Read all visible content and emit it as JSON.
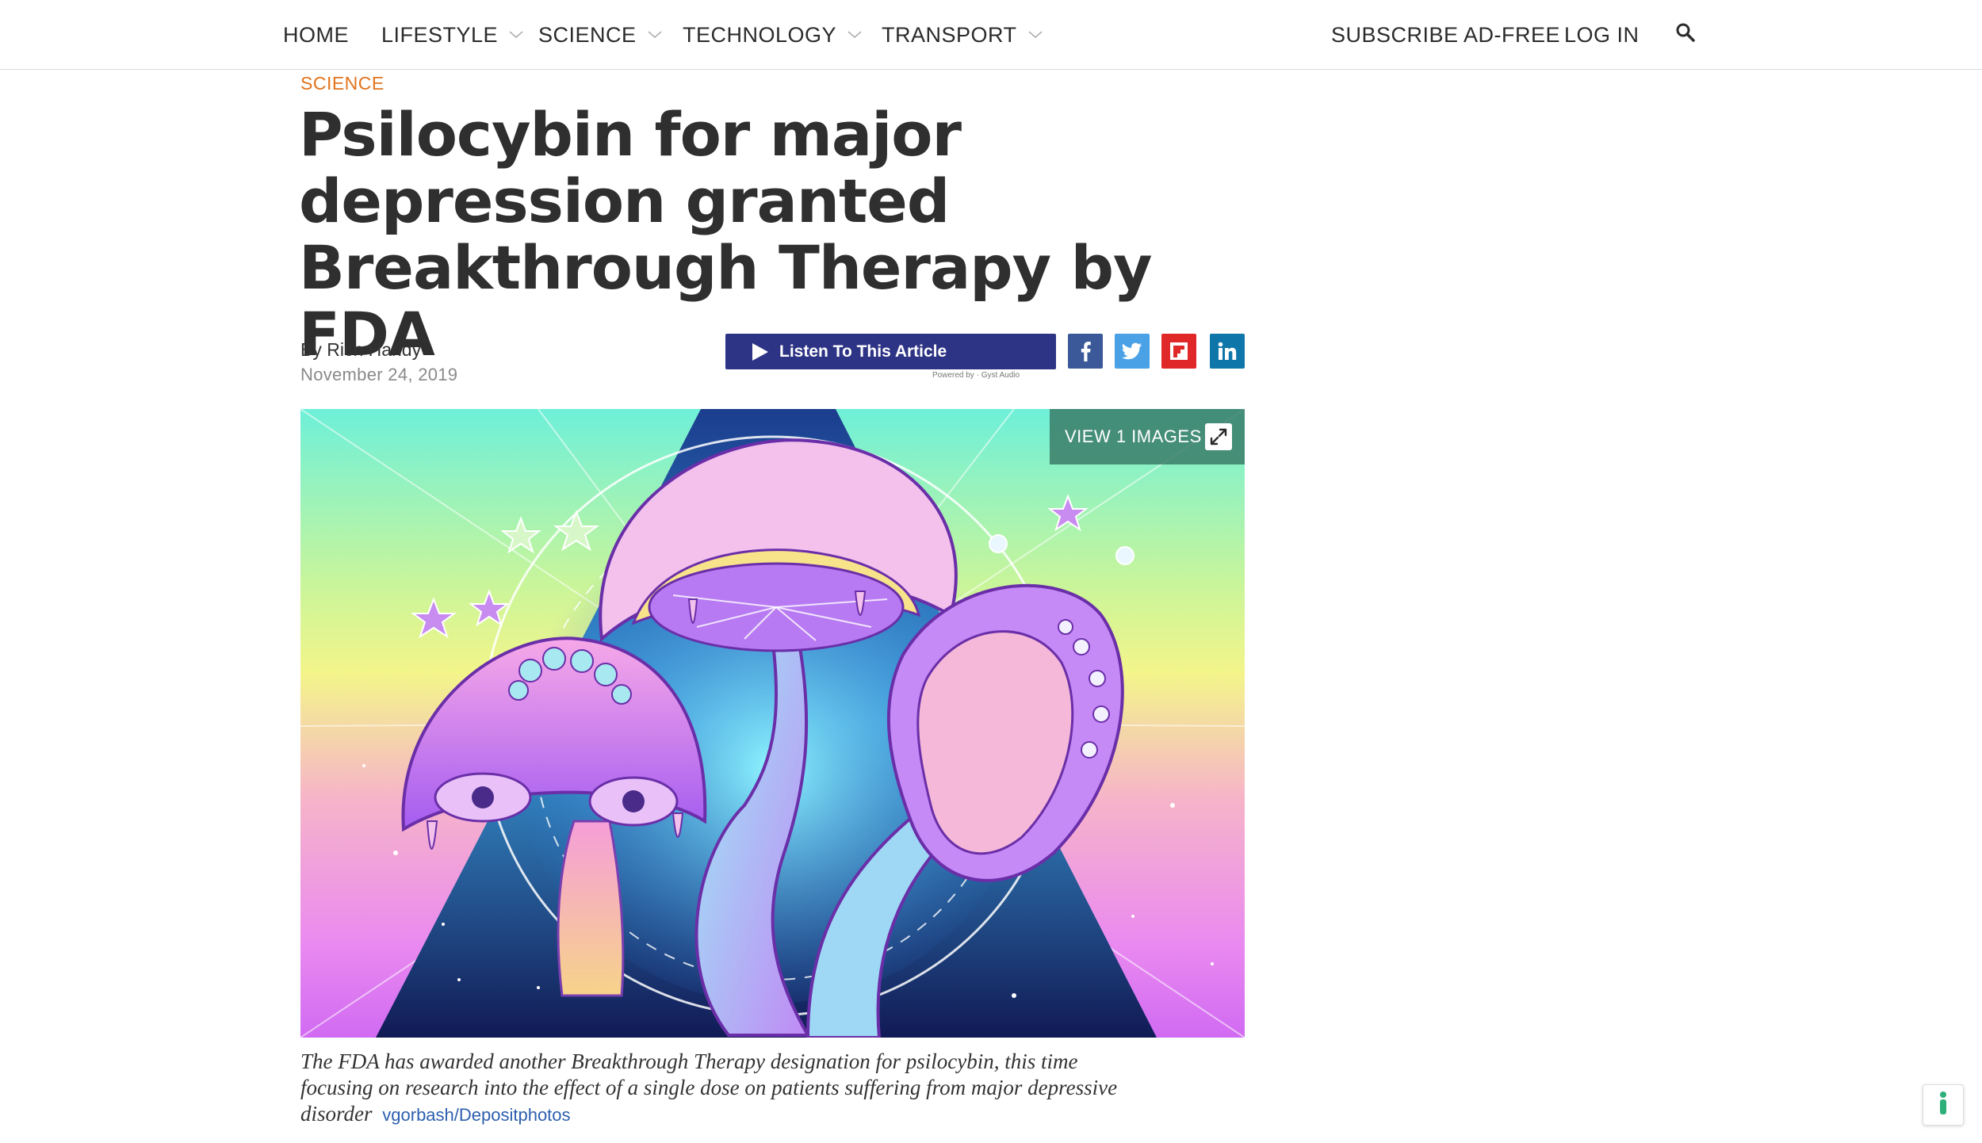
{
  "nav": {
    "home": "HOME",
    "lifestyle": "LIFESTYLE",
    "science": "SCIENCE",
    "technology": "TECHNOLOGY",
    "transport": "TRANSPORT",
    "subscribe": "SUBSCRIBE AD-FREE",
    "login": "LOG IN",
    "search_icon": "search-icon",
    "dropdown_icon": "chevron-down-icon"
  },
  "article": {
    "category": "SCIENCE",
    "title": "Psilocybin for major depression granted Breakthrough Therapy by FDA",
    "byline": "By Rich Haridy",
    "date": "November 24, 2019",
    "listen_label": "Listen To This Article",
    "powered_by": "Powered by · Gyst Audio",
    "view_images": "VIEW 1 IMAGES",
    "caption": "The FDA has awarded another Breakthrough Therapy designation for psilocybin, this time focusing on research into the effect of a single dose on patients suffering from major depressive disorder",
    "credit": "vgorbash/Depositphotos"
  },
  "share": {
    "facebook_icon": "facebook-icon",
    "twitter_icon": "twitter-icon",
    "flipboard_icon": "flipboard-icon",
    "linkedin_icon": "linkedin-icon"
  },
  "colors": {
    "category": "#e3731b",
    "listen_button": "#2e3485",
    "facebook": "#3b5998",
    "twitter": "#4aa1e6",
    "flipboard": "#e12828",
    "linkedin": "#0e76a8",
    "credit_link": "#2d5fae"
  }
}
